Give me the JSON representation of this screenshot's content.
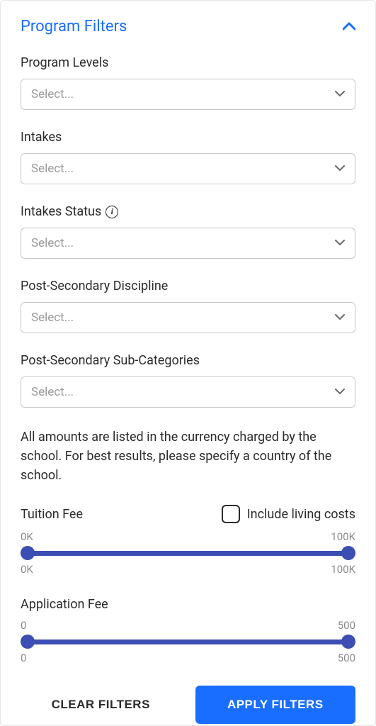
{
  "panel": {
    "title": "Program Filters"
  },
  "filters": {
    "programLevels": {
      "label": "Program Levels",
      "placeholder": "Select..."
    },
    "intakes": {
      "label": "Intakes",
      "placeholder": "Select..."
    },
    "intakesStatus": {
      "label": "Intakes Status",
      "placeholder": "Select..."
    },
    "discipline": {
      "label": "Post-Secondary Discipline",
      "placeholder": "Select..."
    },
    "subCategories": {
      "label": "Post-Secondary Sub-Categories",
      "placeholder": "Select..."
    }
  },
  "infoText": "All amounts are listed in the currency charged by the school. For best results, please specify a country of the school.",
  "tuition": {
    "label": "Tuition Fee",
    "checkboxLabel": "Include living costs",
    "minTop": "0K",
    "maxTop": "100K",
    "minBottom": "0K",
    "maxBottom": "100K"
  },
  "application": {
    "label": "Application Fee",
    "minTop": "0",
    "maxTop": "500",
    "minBottom": "0",
    "maxBottom": "500"
  },
  "buttons": {
    "clear": "CLEAR FILTERS",
    "apply": "APPLY FILTERS"
  }
}
